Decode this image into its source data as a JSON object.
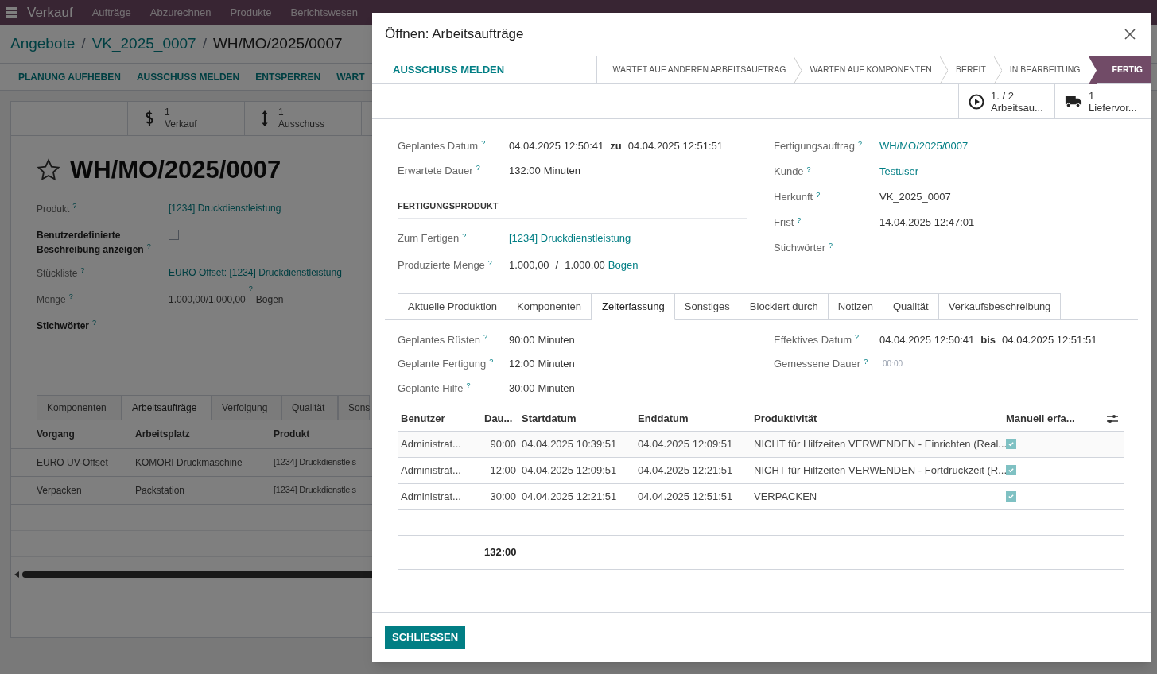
{
  "nav": {
    "app": "Verkauf",
    "menus": [
      "Aufträge",
      "Abzurechnen",
      "Produkte",
      "Berichtswesen"
    ]
  },
  "breadcrumbs": [
    "Angebote",
    "VK_2025_0007",
    "WH/MO/2025/0007"
  ],
  "breadcrumb_separator": "/",
  "actions": [
    "PLANUNG AUFHEBEN",
    "AUSSCHUSS MELDEN",
    "ENTSPERREN",
    "WART"
  ],
  "stat_buttons": [
    {
      "value": "1",
      "label": "Verkauf"
    },
    {
      "value": "1",
      "label": "Ausschuss"
    }
  ],
  "record": {
    "title": "WH/MO/2025/0007",
    "starred": false,
    "fields": [
      {
        "label": "Produkt",
        "help": "?",
        "bold": false,
        "kind": "link",
        "value": "[1234] Druckdienstleistung"
      },
      {
        "label": "Benutzerdefinierte Beschreibung anzeigen",
        "help": "?",
        "bold": true,
        "kind": "checkbox",
        "checked": false
      },
      {
        "label": "Stückliste",
        "help": "?",
        "bold": false,
        "kind": "link",
        "value": "EURO Offset: [1234] Druckdienstleistung"
      },
      {
        "label": "Menge",
        "help": "?",
        "bold": false,
        "kind": "quantity",
        "value": "1.000,00/1.000,00",
        "value_help": "?",
        "unit": "Bogen"
      },
      {
        "label": "Stichwörter",
        "help": "?",
        "bold": true,
        "kind": "empty"
      }
    ]
  },
  "notebook": {
    "tabs": [
      {
        "label": "Komponenten",
        "selected": false
      },
      {
        "label": "Arbeitsaufträge",
        "selected": true
      },
      {
        "label": "Verfolgung",
        "selected": false
      },
      {
        "label": "Qualität",
        "selected": false
      },
      {
        "label": "Sons",
        "selected": false
      }
    ],
    "columns": [
      "Vorgang",
      "Arbeitsplatz",
      "Produkt"
    ],
    "rows": [
      [
        "EURO UV-Offset",
        "KOMORI Druckmaschine",
        "[1234] Druckdienstleis"
      ],
      [
        "Verpacken",
        "Packstation",
        "[1234] Druckdienstleis"
      ]
    ]
  },
  "dialog": {
    "title": "Öffnen: Arbeitsaufträge",
    "action_button": "AUSSCHUSS MELDEN",
    "stages": [
      {
        "label": "WARTET AUF ANDEREN ARBEITSAUFTRAG",
        "selected": false
      },
      {
        "label": "WARTEN AUF KOMPONENTEN",
        "selected": false
      },
      {
        "label": "BEREIT",
        "selected": false
      },
      {
        "label": "IN BEARBEITUNG",
        "selected": false
      },
      {
        "label": "FERTIG",
        "selected": true
      }
    ],
    "smart_buttons": [
      {
        "value": "1. / 2",
        "label": "Arbeitsau..."
      },
      {
        "value": "1",
        "label": "Liefervor..."
      }
    ],
    "left_fields": [
      {
        "label": "Geplantes Datum",
        "help": "?",
        "kind": "range",
        "from": "04.04.2025 12:50:41",
        "sep": "zu",
        "to": "04.04.2025 12:51:51"
      },
      {
        "label": "Erwartete Dauer",
        "help": "?",
        "kind": "duration",
        "value": "132:00",
        "unit": "Minuten"
      }
    ],
    "section": "FERTIGUNGSPRODUKT",
    "product_fields": [
      {
        "label": "Zum Fertigen",
        "help": "?",
        "kind": "link",
        "value": "[1234] Druckdienstleistung"
      },
      {
        "label": "Produzierte Menge",
        "help": "?",
        "kind": "quantity",
        "value": "1.000,00",
        "sep": "/",
        "total": "1.000,00",
        "unit": "Bogen"
      }
    ],
    "right_fields": [
      {
        "label": "Fertigungsauftrag",
        "help": "?",
        "kind": "link",
        "value": "WH/MO/2025/0007"
      },
      {
        "label": "Kunde",
        "help": "?",
        "kind": "link",
        "value": "Testuser"
      },
      {
        "label": "Herkunft",
        "help": "?",
        "kind": "text",
        "value": "VK_2025_0007"
      },
      {
        "label": "Frist",
        "help": "?",
        "kind": "text",
        "value": "14.04.2025 12:47:01"
      },
      {
        "label": "Stichwörter",
        "help": "?",
        "kind": "empty"
      }
    ],
    "tabs": [
      {
        "label": "Aktuelle Produktion",
        "selected": false
      },
      {
        "label": "Komponenten",
        "selected": false
      },
      {
        "label": "Zeiterfassung",
        "selected": true
      },
      {
        "label": "Sonstiges",
        "selected": false
      },
      {
        "label": "Blockiert durch",
        "selected": false
      },
      {
        "label": "Notizen",
        "selected": false
      },
      {
        "label": "Qualität",
        "selected": false
      },
      {
        "label": "Verkaufsbeschreibung",
        "selected": false
      }
    ],
    "time_left": [
      {
        "label": "Geplantes Rüsten",
        "help": "?",
        "kind": "duration",
        "value": "90:00",
        "unit": "Minuten"
      },
      {
        "label": "Geplante Fertigung",
        "help": "?",
        "kind": "duration",
        "value": "12:00",
        "unit": "Minuten"
      },
      {
        "label": "Geplante Hilfe",
        "help": "?",
        "kind": "duration",
        "value": "30:00",
        "unit": "Minuten"
      }
    ],
    "time_right": [
      {
        "label": "Effektives Datum",
        "help": "?",
        "kind": "range",
        "from": "04.04.2025 12:50:41",
        "sep": "bis",
        "to": "04.04.2025 12:51:51"
      },
      {
        "label": "Gemessene Dauer",
        "help": "?",
        "kind": "small",
        "value": "00:00"
      }
    ],
    "time_table": {
      "columns": [
        "Benutzer",
        "Dau...",
        "Startdatum",
        "Enddatum",
        "Produktivität",
        "Manuell erfa..."
      ],
      "rows": [
        {
          "user": "Administrat...",
          "duration": "90:00",
          "start": "04.04.2025 10:39:51",
          "end": "04.04.2025 12:09:51",
          "productivity": "NICHT für Hilfzeiten VERWENDEN - Einrichten (Real...",
          "manual": true
        },
        {
          "user": "Administrat...",
          "duration": "12:00",
          "start": "04.04.2025 12:09:51",
          "end": "04.04.2025 12:21:51",
          "productivity": "NICHT für Hilfzeiten VERWENDEN - Fortdruckzeit (R...",
          "manual": true
        },
        {
          "user": "Administrat...",
          "duration": "30:00",
          "start": "04.04.2025 12:21:51",
          "end": "04.04.2025 12:51:51",
          "productivity": "VERPACKEN",
          "manual": true
        }
      ],
      "total": "132:00"
    },
    "close_button": "SCHLIESSEN"
  }
}
